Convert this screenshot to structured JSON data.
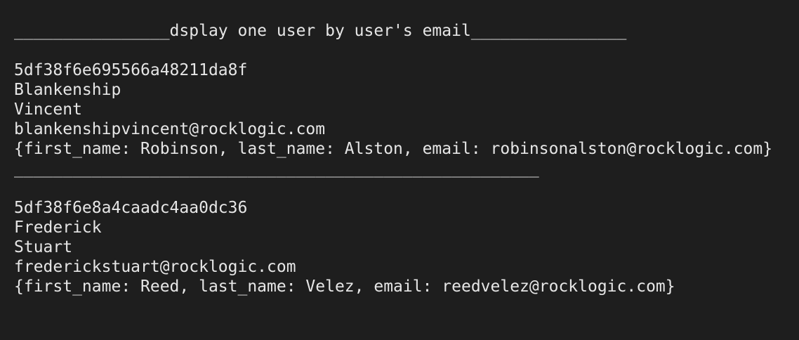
{
  "terminal": {
    "header": "________________dsplay one user by user's email________________",
    "records": [
      {
        "id": "5df38f6e695566a48211da8f",
        "last_name": "Blankenship",
        "first_name": "Vincent",
        "email": "blankenshipvincent@rocklogic.com",
        "json": "{first_name: Robinson, last_name: Alston, email: robinsonalston@rocklogic.com}"
      },
      {
        "id": "5df38f6e8a4caadc4aa0dc36",
        "last_name": "Frederick",
        "first_name": "Stuart",
        "email": "frederickstuart@rocklogic.com",
        "json": "{first_name: Reed, last_name: Velez, email: reedvelez@rocklogic.com}"
      }
    ],
    "separator": "______________________________________________________"
  }
}
